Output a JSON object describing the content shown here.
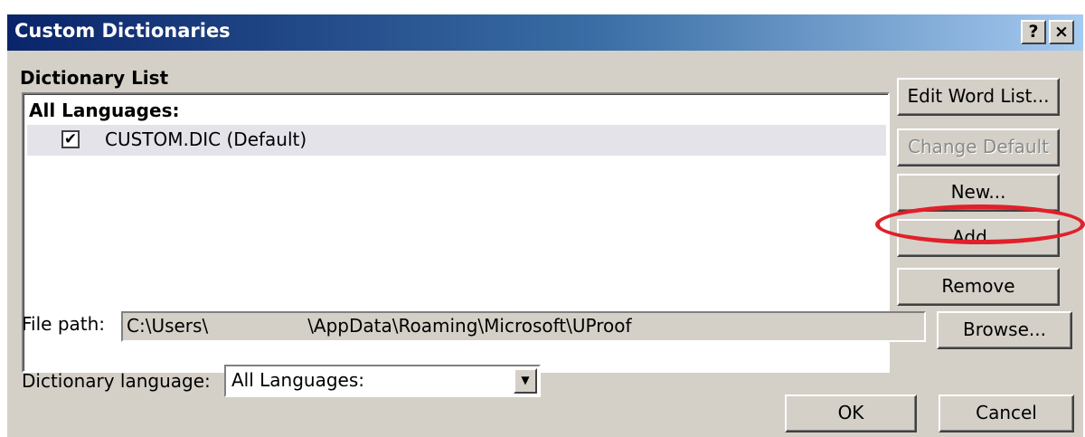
{
  "window": {
    "title": "Custom Dictionaries",
    "help_button": "?",
    "close_button": "×"
  },
  "dictionary_list": {
    "label": "Dictionary List",
    "group_header": "All Languages:",
    "items": [
      {
        "checked": true,
        "check_mark": "✔",
        "label": "CUSTOM.DIC (Default)"
      }
    ]
  },
  "buttons": {
    "edit_word_list": "Edit Word List...",
    "change_default": "Change Default",
    "new": "New...",
    "add": "Add...",
    "remove": "Remove",
    "browse": "Browse...",
    "ok": "OK",
    "cancel": "Cancel"
  },
  "file_path": {
    "label": "File path:",
    "value_start": "C:\\Users\\",
    "value_end": "\\AppData\\Roaming\\Microsoft\\UProof"
  },
  "dictionary_language": {
    "label": "Dictionary language:",
    "selected": "All Languages:",
    "arrow_icon": "▼"
  },
  "colors": {
    "dialog_face": "#d4d0c8",
    "title_gradient_start": "#0a246a",
    "highlight_oval": "#e0202a",
    "selected_row": "#e4e3ea"
  }
}
